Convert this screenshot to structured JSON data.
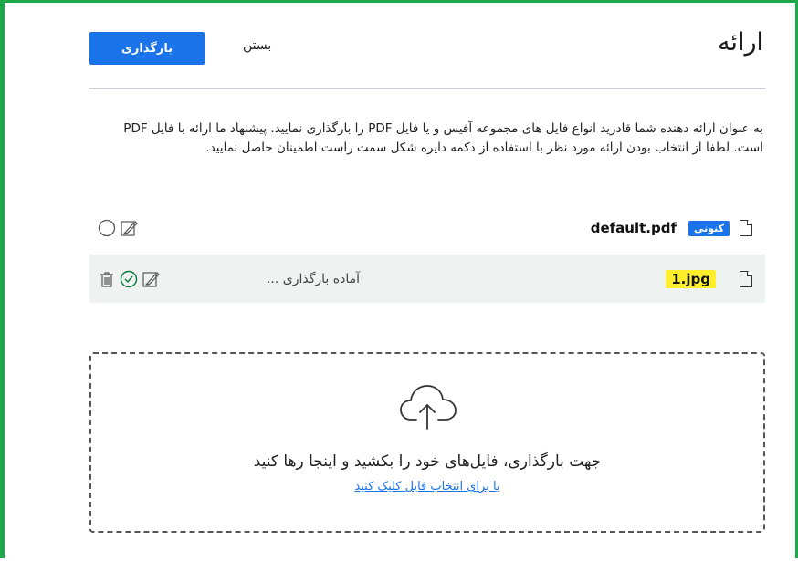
{
  "header": {
    "title": "ارائه",
    "close_label": "بستن",
    "upload_label": "بارگذاری"
  },
  "description": "به عنوان ارائه دهنده شما قادرید انواع فایل های مجموعه آفیس و یا فایل PDF را بارگذاری نمایید. پیشنهاد ما ارائه با فایل PDF است. لطفا از انتخاب بودن ارائه مورد نظر با استفاده از دکمه دایره شکل سمت راست اطمینان حاصل نمایید.",
  "files": [
    {
      "name": "default.pdf",
      "badge": "کنونی",
      "status": ""
    },
    {
      "name": "1.jpg",
      "badge": "",
      "status": "آماده بارگذاری ..."
    }
  ],
  "dropzone": {
    "main_text": "جهت بارگذاری، فایل‌های خود را بکشید و اینجا رها کنید",
    "link_text": "یا برای انتخاب فایل کلیک کنید"
  },
  "colors": {
    "accent": "#1a73e8",
    "frame": "#1fa84a",
    "highlight": "#ffef2a",
    "pending_row_bg": "#eef3f1"
  },
  "icons": [
    "file-icon",
    "radio-circle-icon",
    "edit-icon",
    "check-circle-icon",
    "trash-icon",
    "cloud-upload-icon"
  ]
}
